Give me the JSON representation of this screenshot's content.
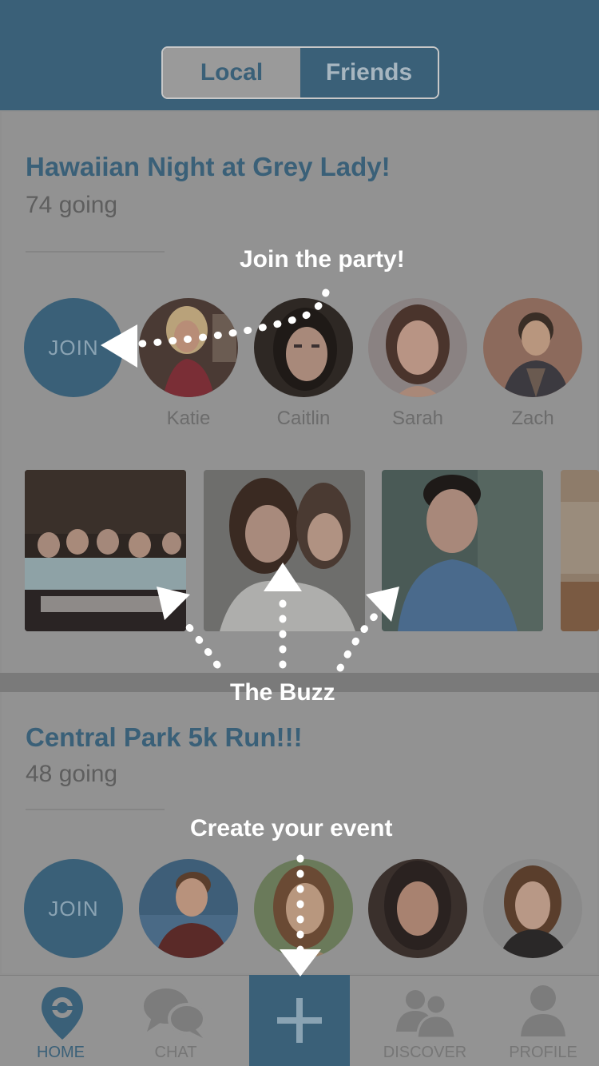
{
  "header": {
    "tabs": [
      {
        "label": "Local"
      },
      {
        "label": "Friends"
      }
    ]
  },
  "events": [
    {
      "title": "Hawaiian Night at Grey Lady!",
      "going": "74 going",
      "join_label": "JOIN",
      "attendees": [
        {
          "name": "Katie"
        },
        {
          "name": "Caitlin"
        },
        {
          "name": "Sarah"
        },
        {
          "name": "Zach"
        }
      ]
    },
    {
      "title": "Central Park 5k Run!!!",
      "going": "48 going",
      "join_label": "JOIN"
    }
  ],
  "annotations": {
    "join": "Join the party!",
    "buzz": "The Buzz",
    "create": "Create your event"
  },
  "tabbar": {
    "home": "HOME",
    "chat": "CHAT",
    "discover": "DISCOVER",
    "profile": "PROFILE"
  },
  "colors": {
    "brand": "#3a6078",
    "overlay_gray": "#929292"
  },
  "icons": [
    "pin-icon",
    "chat-bubbles-icon",
    "plus-icon",
    "people-icon",
    "person-icon"
  ]
}
